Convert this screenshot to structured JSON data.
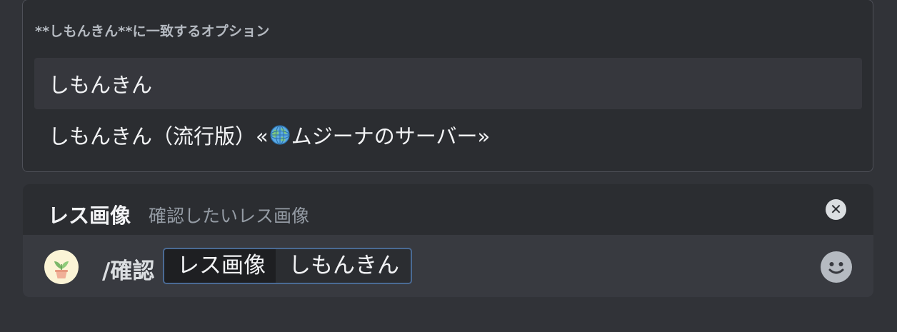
{
  "autocomplete": {
    "header": "**しもんきん**に一致するオプション",
    "options": [
      {
        "label": "しもんきん",
        "selected": true
      },
      {
        "label_before": "しもんきん（流行版）«",
        "icon": "globe-icon",
        "label_after": "ムジーナのサーバー»",
        "selected": false
      }
    ]
  },
  "option_panel": {
    "name": "レス画像",
    "description": "確認したいレス画像"
  },
  "input": {
    "avatar_icon": "potted-plant-icon",
    "command": "/確認",
    "arg_name": "レス画像",
    "arg_value": "しもんきん",
    "emoji_icon": "smile-icon"
  },
  "colors": {
    "background": "#313338",
    "popup": "#2b2d31",
    "selected": "#36373d",
    "accent_border": "#4a6a94"
  }
}
